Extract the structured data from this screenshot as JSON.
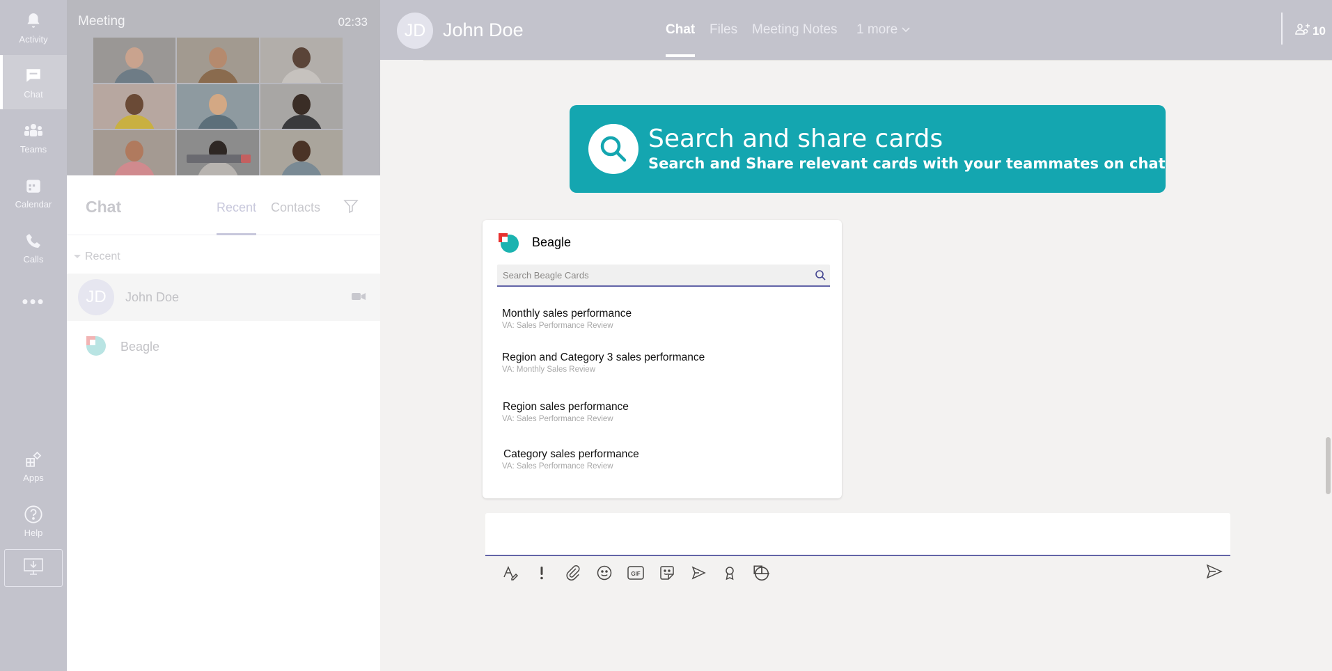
{
  "rail": {
    "items": [
      {
        "label": "Activity",
        "icon": "bell-icon"
      },
      {
        "label": "Chat",
        "icon": "chat-icon"
      },
      {
        "label": "Teams",
        "icon": "teams-icon"
      },
      {
        "label": "Calendar",
        "icon": "calendar-icon"
      },
      {
        "label": "Calls",
        "icon": "phone-icon"
      },
      {
        "label": "Apps",
        "icon": "apps-icon"
      },
      {
        "label": "Help",
        "icon": "help-icon"
      }
    ],
    "more": "•••"
  },
  "meeting": {
    "title": "Meeting",
    "time": "02:33"
  },
  "chat_list": {
    "title": "Chat",
    "tabs": [
      "Recent",
      "Contacts"
    ],
    "section": "Recent",
    "rows": [
      {
        "initials": "JD",
        "name": "John Doe"
      },
      {
        "name": "Beagle"
      }
    ]
  },
  "header": {
    "initials": "JD",
    "name": "John Doe",
    "tabs": [
      "Chat",
      "Files",
      "Meeting Notes",
      "1 more"
    ],
    "active_tab": "Chat",
    "participants": "10"
  },
  "banner": {
    "title": "Search and share cards",
    "subtitle": "Search and Share relevant cards with your teammates on chat"
  },
  "card": {
    "title": "Beagle",
    "search_placeholder": "Search Beagle Cards",
    "items": [
      {
        "title": "Monthly sales performance",
        "subtitle": "VA: Sales Performance Review"
      },
      {
        "title": "Region and Category 3 sales performance",
        "subtitle": "VA: Monthly Sales Review"
      },
      {
        "title": "Region sales performance",
        "subtitle": "VA: Sales Performance Review"
      },
      {
        "title": "Category sales performance",
        "subtitle": "VA: Sales Performance Review"
      }
    ]
  },
  "colors": {
    "accent": "#6264a7",
    "banner": "#14a6b0",
    "rail": "#c3c3cc",
    "beagle_red": "#e8312f",
    "beagle_teal": "#1bb3b0"
  }
}
